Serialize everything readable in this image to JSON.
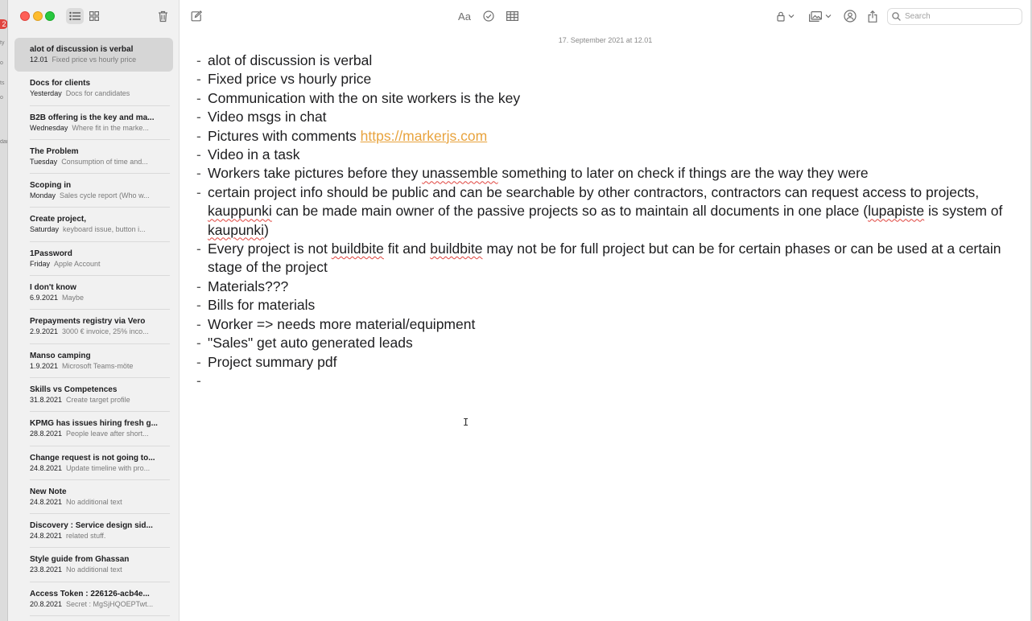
{
  "edge": {
    "badge": "2",
    "fragments": [
      "ty",
      "o",
      "ts",
      "o",
      "dar"
    ]
  },
  "toolbar": {
    "format_label": "Aa",
    "search_placeholder": "Search"
  },
  "notes": [
    {
      "title": "alot of discussion is verbal",
      "date": "12.01",
      "preview": "Fixed price vs hourly price",
      "selected": true
    },
    {
      "title": "Docs for clients",
      "date": "Yesterday",
      "preview": "Docs for candidates"
    },
    {
      "title": "B2B offering is the key and ma...",
      "date": "Wednesday",
      "preview": "Where fit in the marke..."
    },
    {
      "title": "The Problem",
      "date": "Tuesday",
      "preview": "Consumption of time and..."
    },
    {
      "title": "Scoping in",
      "date": "Monday",
      "preview": "Sales cycle report (Who w..."
    },
    {
      "title": "Create project,",
      "date": "Saturday",
      "preview": "keyboard issue, button i..."
    },
    {
      "title": "1Password",
      "date": "Friday",
      "preview": "Apple Account"
    },
    {
      "title": "I don't know",
      "date": "6.9.2021",
      "preview": "Maybe"
    },
    {
      "title": "Prepayments registry via Vero",
      "date": "2.9.2021",
      "preview": "3000 € invoice, 25% inco..."
    },
    {
      "title": "Manso camping",
      "date": "1.9.2021",
      "preview": "Microsoft Teams-möte"
    },
    {
      "title": "Skills vs Competences",
      "date": "31.8.2021",
      "preview": "Create target profile"
    },
    {
      "title": "KPMG has issues hiring fresh g...",
      "date": "28.8.2021",
      "preview": "People leave after short..."
    },
    {
      "title": "Change request is not going to...",
      "date": "24.8.2021",
      "preview": "Update timeline with pro..."
    },
    {
      "title": "New Note",
      "date": "24.8.2021",
      "preview": "No additional text"
    },
    {
      "title": "Discovery : Service design sid...",
      "date": "24.8.2021",
      "preview": "related stuff."
    },
    {
      "title": "Style guide from Ghassan",
      "date": "23.8.2021",
      "preview": "No additional text"
    },
    {
      "title": "Access Token : 226126-acb4e...",
      "date": "20.8.2021",
      "preview": "Secret : MgSjHQOEPTwt..."
    }
  ],
  "editor": {
    "date_header": "17. September 2021 at 12.01",
    "dash": "-",
    "lines": [
      [
        {
          "t": "alot of discussion is verbal"
        }
      ],
      [
        {
          "t": "Fixed price vs hourly price"
        }
      ],
      [
        {
          "t": "Communication with the on site workers is the key"
        }
      ],
      [
        {
          "t": "Video msgs in chat"
        }
      ],
      [
        {
          "t": "Pictures with comments "
        },
        {
          "t": "https://markerjs.com",
          "link": true
        }
      ],
      [
        {
          "t": "Video in a task"
        }
      ],
      [
        {
          "t": "Workers take pictures before they "
        },
        {
          "t": "unassemble",
          "sp": true
        },
        {
          "t": " something to later on check if things are the way they were"
        }
      ],
      [
        {
          "t": "certain project info should be public and can be searchable by other contractors, contractors can request access to projects, "
        },
        {
          "t": "kauppunki",
          "sp": true
        },
        {
          "t": " can be made main owner of the passive projects so as to maintain all documents in one place ("
        },
        {
          "t": "lupapiste",
          "sp": true
        },
        {
          "t": " is system of "
        },
        {
          "t": "kaupunki",
          "sp": true
        },
        {
          "t": ")"
        }
      ],
      [
        {
          "t": "Every project is not "
        },
        {
          "t": "buildbite",
          "sp": true
        },
        {
          "t": " fit and "
        },
        {
          "t": "buildbite",
          "sp": true
        },
        {
          "t": " may not be for full project but can be for certain phases or can be used at a certain stage of the project"
        }
      ],
      [
        {
          "t": "Materials???"
        }
      ],
      [
        {
          "t": "Bills for materials"
        }
      ],
      [
        {
          "t": "Worker => needs more material/equipment"
        }
      ],
      [
        {
          "t": "\"Sales\" get auto generated leads"
        }
      ],
      [
        {
          "t": "Project summary pdf"
        }
      ],
      []
    ]
  },
  "cursor_glyph": "I"
}
